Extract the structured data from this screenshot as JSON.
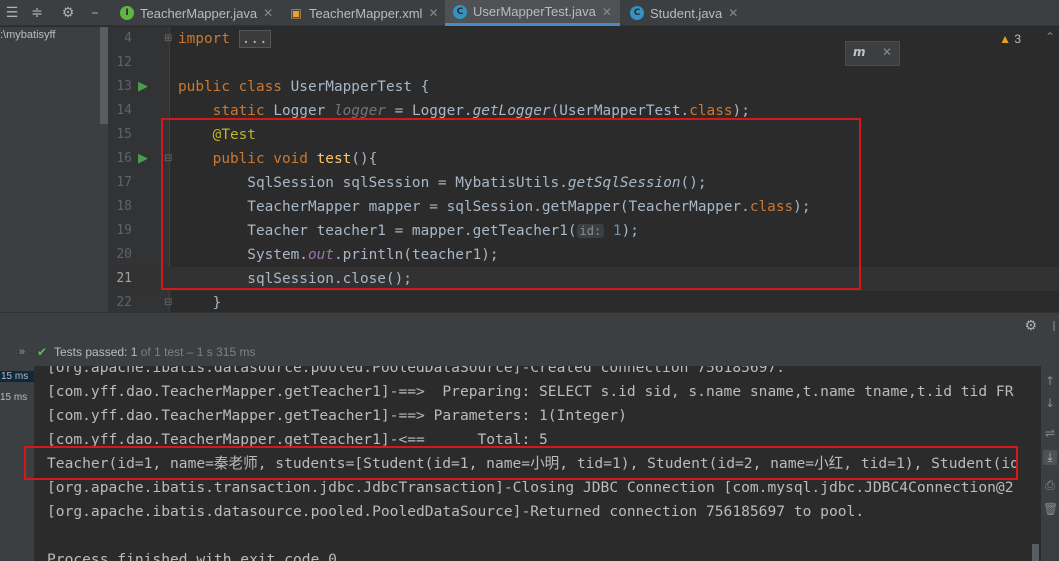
{
  "tabs": [
    {
      "label": "TeacherMapper.java",
      "icon": "interface-java-icon",
      "active": false
    },
    {
      "label": "TeacherMapper.xml",
      "icon": "xml-file-icon",
      "active": false
    },
    {
      "label": "UserMapperTest.java",
      "icon": "class-java-icon",
      "active": true
    },
    {
      "label": "Student.java",
      "icon": "class-java-icon",
      "active": false
    }
  ],
  "project": {
    "path_fragment": ":\\mybatisyff"
  },
  "editor": {
    "warning_count": "3",
    "maven_label": "m",
    "lines": [
      {
        "num": "4",
        "parts": [
          [
            "kw",
            "import "
          ],
          [
            "fold",
            "..."
          ]
        ]
      },
      {
        "num": "12",
        "parts": []
      },
      {
        "num": "13",
        "parts": [
          [
            "kw",
            "public class "
          ],
          [
            "plain",
            "UserMapperTest {"
          ]
        ]
      },
      {
        "num": "14",
        "parts": [
          [
            "plain",
            "    "
          ],
          [
            "kw",
            "static "
          ],
          [
            "plain",
            "Logger "
          ],
          [
            "muted",
            "logger"
          ],
          [
            "plain",
            " = Logger."
          ],
          [
            "it",
            "getLogger"
          ],
          [
            "plain",
            "(UserMapperTest."
          ],
          [
            "kw",
            "class"
          ],
          [
            "plain",
            ");"
          ]
        ]
      },
      {
        "num": "15",
        "parts": [
          [
            "plain",
            "    "
          ],
          [
            "ann",
            "@Test"
          ]
        ]
      },
      {
        "num": "16",
        "parts": [
          [
            "plain",
            "    "
          ],
          [
            "kw",
            "public void "
          ],
          [
            "fn",
            "test"
          ],
          [
            "plain",
            "(){"
          ]
        ]
      },
      {
        "num": "17",
        "parts": [
          [
            "plain",
            "        SqlSession sqlSession = MybatisUtils."
          ],
          [
            "it",
            "getSqlSession"
          ],
          [
            "plain",
            "();"
          ]
        ]
      },
      {
        "num": "18",
        "parts": [
          [
            "plain",
            "        TeacherMapper mapper = sqlSession.getMapper(TeacherMapper."
          ],
          [
            "kw",
            "class"
          ],
          [
            "plain",
            ");"
          ]
        ]
      },
      {
        "num": "19",
        "parts": [
          [
            "plain",
            "        Teacher teacher1 = mapper.getTeacher1("
          ],
          [
            "hint",
            "id:"
          ],
          [
            "num",
            " 1"
          ],
          [
            "plain",
            ");"
          ]
        ]
      },
      {
        "num": "20",
        "parts": [
          [
            "plain",
            "        System."
          ],
          [
            "sfield",
            "out"
          ],
          [
            "plain",
            ".println(teacher1);"
          ]
        ]
      },
      {
        "num": "21",
        "parts": [
          [
            "plain",
            "        sqlSession.close();"
          ]
        ]
      },
      {
        "num": "22",
        "parts": [
          [
            "plain",
            "    }"
          ]
        ]
      }
    ]
  },
  "test_status": {
    "passed_label": "Tests passed:",
    "passed_count": "1",
    "detail": "of 1 test – 1 s 315 ms"
  },
  "timings": [
    "15 ms",
    "15 ms"
  ],
  "console": [
    "[org.apache.ibatis.datasource.pooled.PooledDataSource]-Created connection 756185697.",
    "[com.yff.dao.TeacherMapper.getTeacher1]-==>  Preparing: SELECT s.id sid, s.name sname,t.name tname,t.id tid FR",
    "[com.yff.dao.TeacherMapper.getTeacher1]-==> Parameters: 1(Integer)",
    "[com.yff.dao.TeacherMapper.getTeacher1]-<==      Total: 5",
    "Teacher(id=1, name=秦老师, students=[Student(id=1, name=小明, tid=1), Student(id=2, name=小红, tid=1), Student(id",
    "[org.apache.ibatis.transaction.jdbc.JdbcTransaction]-Closing JDBC Connection [com.mysql.jdbc.JDBC4Connection@2",
    "[org.apache.ibatis.datasource.pooled.PooledDataSource]-Returned connection 756185697 to pool.",
    "",
    "Process finished with exit code 0"
  ],
  "colors": {
    "accent": "#4a88c7",
    "highlight_box": "#d31919",
    "pass_green": "#5fb85f"
  }
}
